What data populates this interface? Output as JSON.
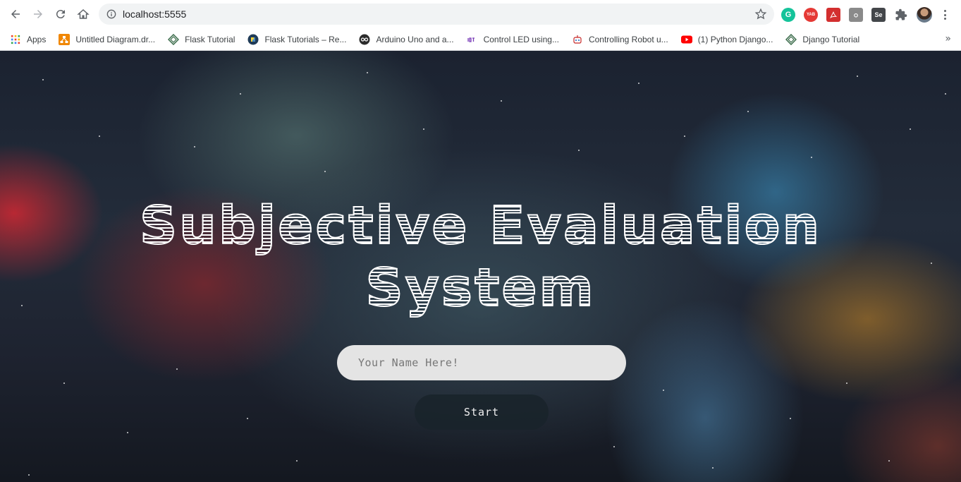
{
  "browser": {
    "url": "localhost:5555",
    "bookmarks": [
      {
        "label": "Apps",
        "icon": "apps-grid-icon"
      },
      {
        "label": "Untitled Diagram.dr...",
        "icon": "drawio-icon"
      },
      {
        "label": "Flask Tutorial",
        "icon": "diamond-icon"
      },
      {
        "label": "Flask Tutorials – Re...",
        "icon": "realpython-icon"
      },
      {
        "label": "Arduino Uno and a...",
        "icon": "arduino-icon"
      },
      {
        "label": "Control LED using...",
        "icon": "iot-icon"
      },
      {
        "label": "Controlling Robot u...",
        "icon": "robot-icon"
      },
      {
        "label": "(1) Python Django...",
        "icon": "youtube-icon"
      },
      {
        "label": "Django Tutorial",
        "icon": "diamond-icon"
      }
    ],
    "more_bookmarks": "»",
    "extensions": {
      "grammarly": "G",
      "yab": "YAB",
      "se": "Se"
    }
  },
  "page": {
    "title_line1": "Subjective Evaluation",
    "title_line2": "System",
    "name_placeholder": "Your Name Here!",
    "start_label": "Start"
  }
}
